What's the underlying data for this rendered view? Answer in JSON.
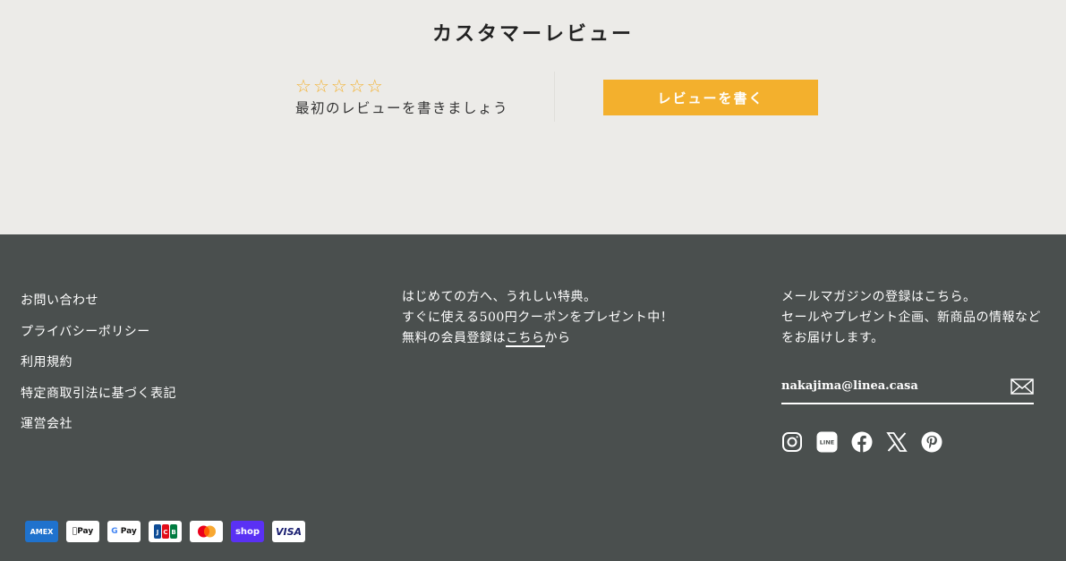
{
  "reviews": {
    "title": "カスタマーレビュー",
    "rating": 0,
    "max_rating": 5,
    "empty_text": "最初のレビューを書きましょう",
    "write_button": "レビューを書く",
    "star_color": "#f3b02d"
  },
  "footer": {
    "links": [
      {
        "label": "お問い合わせ"
      },
      {
        "label": "プライバシーポリシー"
      },
      {
        "label": "利用規約"
      },
      {
        "label": "特定商取引法に基づく表記"
      },
      {
        "label": "運営会社"
      }
    ],
    "promo": {
      "line1": "はじめての方へ、うれしい特典。",
      "line2": "すぐに使える500円クーポンをプレゼント中！",
      "line3_prefix": "無料の会員登録は",
      "line3_link": "こちら",
      "line3_suffix": "から"
    },
    "newsletter": {
      "line1": "メールマガジンの登録はこちら。",
      "line2": "セールやプレゼント企画、新商品の情報など",
      "line3": "をお届けします。",
      "email_value": "nakajima@linea.casa",
      "submit_icon": "envelope-icon"
    },
    "social": [
      "instagram-icon",
      "line-icon",
      "facebook-icon",
      "x-icon",
      "pinterest-icon"
    ],
    "payments": [
      {
        "name": "amex",
        "label": "AMEX"
      },
      {
        "name": "apple-pay",
        "label": "Pay"
      },
      {
        "name": "google-pay",
        "label": "Pay"
      },
      {
        "name": "jcb",
        "label": "JCB"
      },
      {
        "name": "mastercard",
        "label": ""
      },
      {
        "name": "shop-pay",
        "label": "shop"
      },
      {
        "name": "visa",
        "label": "VISA"
      }
    ]
  }
}
